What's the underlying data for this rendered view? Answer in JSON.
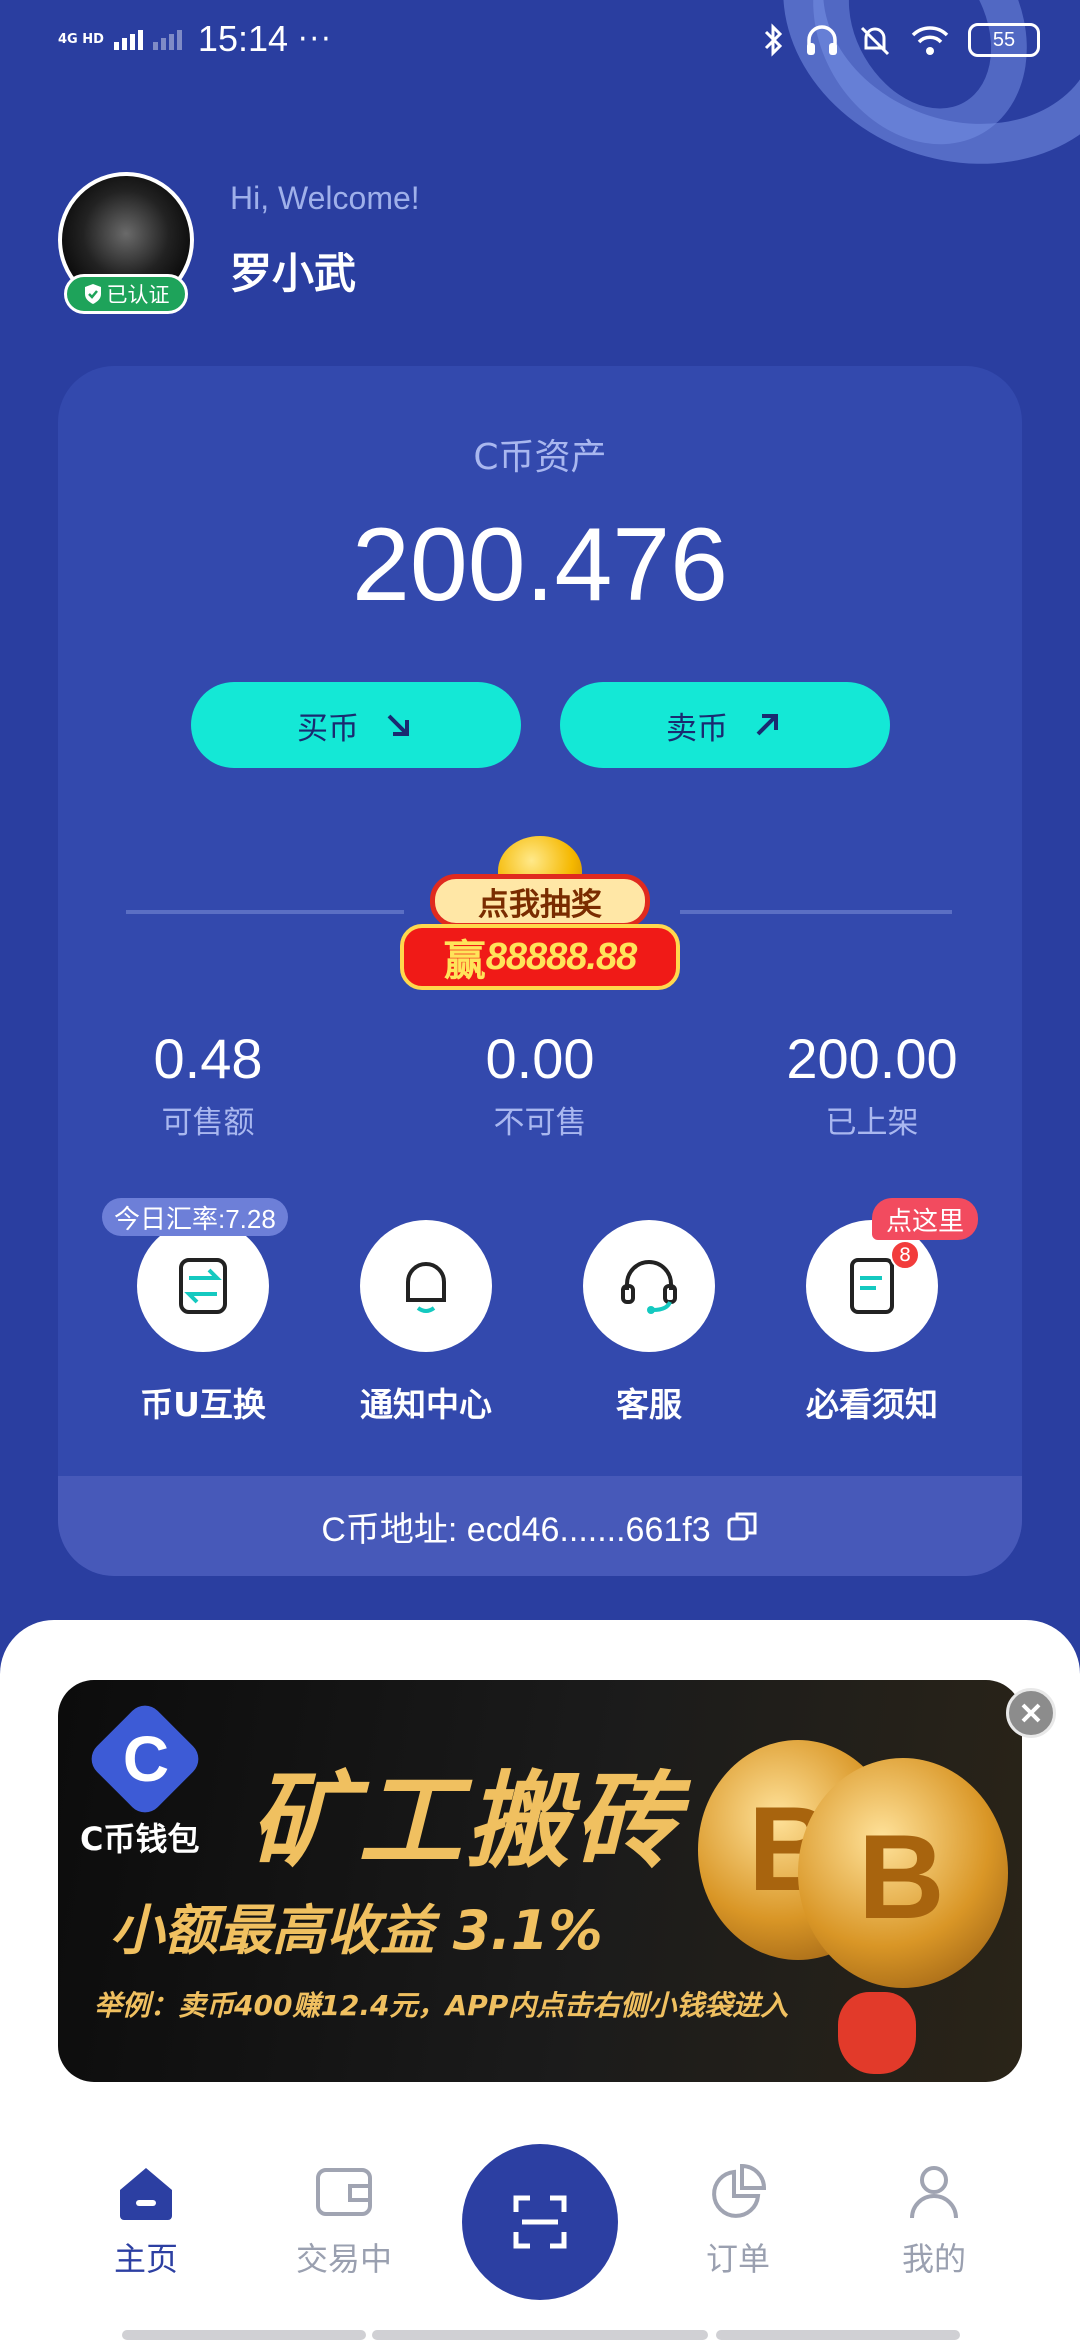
{
  "status_bar": {
    "network": "4G HD",
    "time": "15:14",
    "dots": "···",
    "battery": "55"
  },
  "header": {
    "greeting": "Hi, Welcome!",
    "username": "罗小武",
    "verified_label": "已认证"
  },
  "asset": {
    "label": "C币资产",
    "value": "200.476",
    "buy_label": "买币",
    "sell_label": "卖币"
  },
  "lottery": {
    "tag": "点我抽奖",
    "win_char": "赢",
    "amount": "88888.88"
  },
  "stats": [
    {
      "value": "0.48",
      "label": "可售额"
    },
    {
      "value": "0.00",
      "label": "不可售"
    },
    {
      "value": "200.00",
      "label": "已上架"
    }
  ],
  "features": {
    "rate_tag": "今日汇率:7.28",
    "here_tag": "点这里",
    "notice_badge": "8",
    "items": [
      {
        "label": "币U互换"
      },
      {
        "label": "通知中心"
      },
      {
        "label": "客服"
      },
      {
        "label": "必看须知"
      }
    ]
  },
  "address": {
    "text": "C币地址: ecd46.......661f3"
  },
  "banner": {
    "brand": "C币钱包",
    "title": "矿工搬砖",
    "subtitle": "小额最高收益 3.1%",
    "note": "举例：卖币400赚12.4元，APP内点击右侧小钱袋进入",
    "logo_letter": "C",
    "coin_symbol": "B"
  },
  "tabs": [
    {
      "label": "主页",
      "active": true
    },
    {
      "label": "交易中",
      "active": false
    },
    {
      "label": "订单",
      "active": false
    },
    {
      "label": "我的",
      "active": false
    }
  ],
  "colors": {
    "background": "#2a3ea0",
    "accent": "#14e8d6",
    "active_tab": "#2c3fa2"
  }
}
